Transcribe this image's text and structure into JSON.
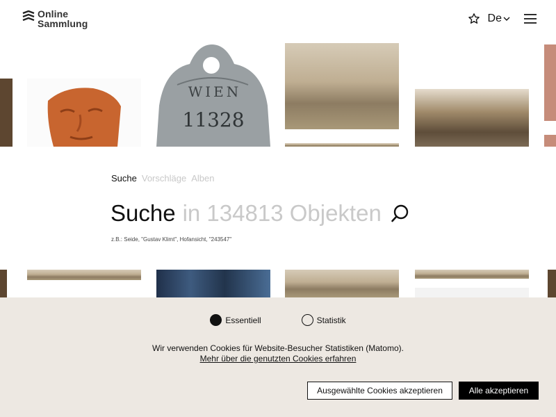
{
  "header": {
    "logo_line1": "Online",
    "logo_line2": "Sammlung",
    "language": "De",
    "icons": [
      "logo-mark",
      "star-icon",
      "chevron-down-icon",
      "menu-icon"
    ]
  },
  "search": {
    "tabs": [
      {
        "label": "Suche",
        "active": true
      },
      {
        "label": "Vorschläge",
        "active": false
      },
      {
        "label": "Alben",
        "active": false
      }
    ],
    "word": "Suche",
    "placeholder": "in 134813 Objekten",
    "example": "z.B.: Seide, \"Gustav Klimt\", Hofansicht, \"243547\""
  },
  "collage": {
    "token_top": "WIEN",
    "token_number": "11328"
  },
  "cookie": {
    "options": [
      {
        "label": "Essentiell",
        "checked": true
      },
      {
        "label": "Statistik",
        "checked": false
      }
    ],
    "text": "Wir verwenden Cookies für Website-Besucher Statistiken (Matomo).",
    "link": "Mehr über die genutzten Cookies erfahren",
    "btn_selected": "Ausgewählte Cookies akzeptieren",
    "btn_all": "Alle akzeptieren"
  },
  "colors": {
    "cookie_bg": "#ede8e2",
    "accent": "#000000",
    "placeholder": "#c9c9c9"
  }
}
